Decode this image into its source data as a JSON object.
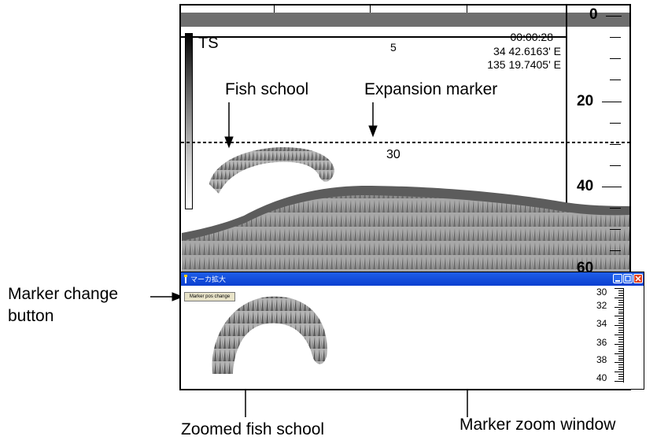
{
  "colorbar": {
    "label": "TS"
  },
  "readout": {
    "time": "00:00:28",
    "lat": "34 42.6163' E",
    "lon": "135 19.7405' E"
  },
  "markers": {
    "top": "5",
    "expansion": "30"
  },
  "depth_scale": {
    "labels": [
      "0",
      "20",
      "40",
      "60"
    ]
  },
  "annotations": {
    "fish_school": "Fish school",
    "expansion_marker": "Expansion marker",
    "marker_change_line1": "Marker change",
    "marker_change_line2": "button",
    "zoomed_fish_school": "Zoomed fish school",
    "marker_zoom_window": "Marker zoom window"
  },
  "zoom_window": {
    "title": "マーカ拡大",
    "button_label": "Marker pos change",
    "depth_labels": [
      "30",
      "32",
      "34",
      "36",
      "38",
      "40"
    ]
  },
  "colors": {
    "titlebar": "#0a3fd0",
    "echo_dark": "#5c5c5c",
    "echo_light": "#a8a8a8",
    "close_button": "#e04020"
  }
}
